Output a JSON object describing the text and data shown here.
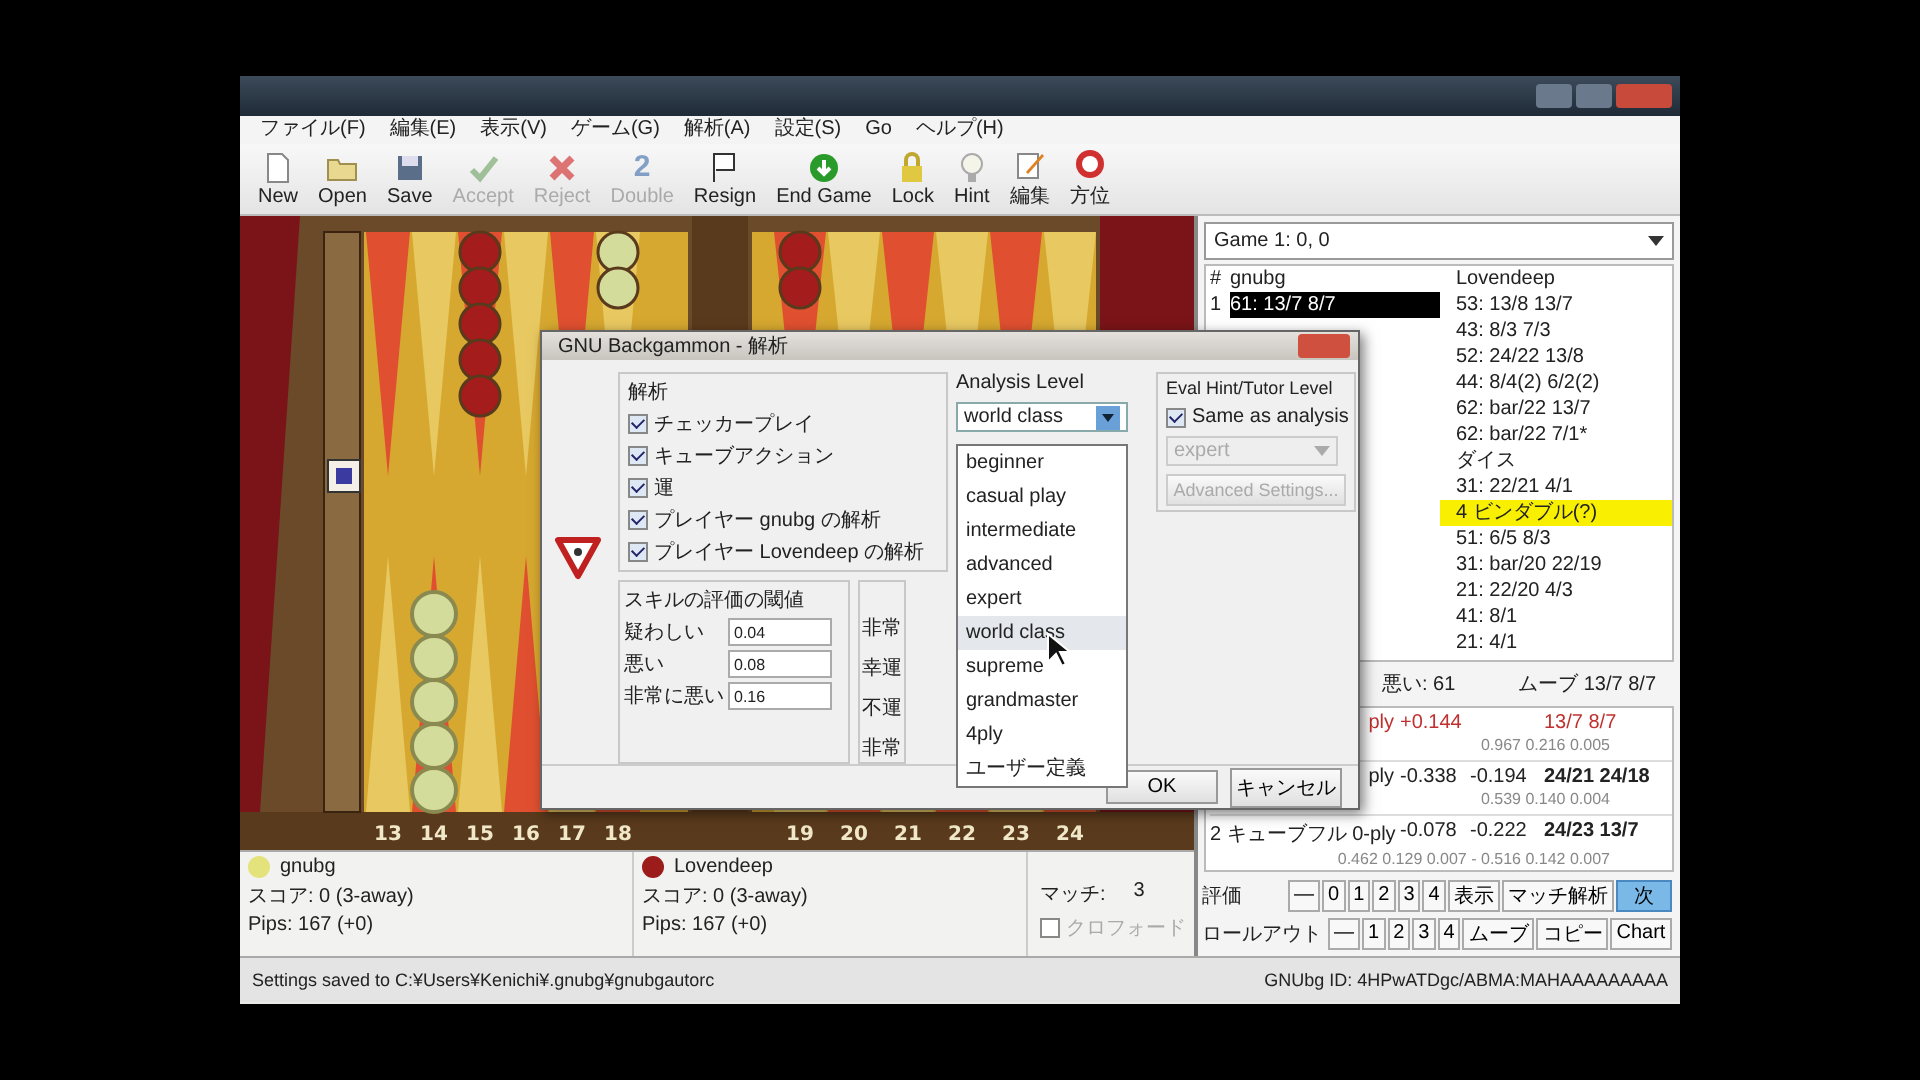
{
  "menu": [
    "ファイル(F)",
    "編集(E)",
    "表示(V)",
    "ゲーム(G)",
    "解析(A)",
    "設定(S)",
    "Go",
    "ヘルプ(H)"
  ],
  "toolbar": [
    {
      "label": "New",
      "kind": "new",
      "disabled": false
    },
    {
      "label": "Open",
      "kind": "open",
      "disabled": false
    },
    {
      "label": "Save",
      "kind": "save",
      "disabled": false
    },
    {
      "label": "Accept",
      "kind": "accept",
      "disabled": true
    },
    {
      "label": "Reject",
      "kind": "reject",
      "disabled": true
    },
    {
      "label": "Double",
      "kind": "double",
      "glyph": "2",
      "disabled": true
    },
    {
      "label": "Resign",
      "kind": "resign",
      "disabled": false
    },
    {
      "label": "End Game",
      "kind": "endgame",
      "disabled": false
    },
    {
      "label": "Lock",
      "kind": "lock",
      "disabled": false
    },
    {
      "label": "Hint",
      "kind": "hint",
      "disabled": false
    },
    {
      "label": "編集",
      "kind": "edit",
      "disabled": false
    },
    {
      "label": "方位",
      "kind": "target",
      "disabled": false
    }
  ],
  "board": {
    "point_numbers": [
      "13",
      "14",
      "15",
      "16",
      "17",
      "18",
      "19",
      "20",
      "21",
      "22",
      "23",
      "24"
    ]
  },
  "players": [
    {
      "name": "gnubg",
      "color": "#e4e27a",
      "score": "スコア: 0 (3-away)",
      "pips": "Pips: 167 (+0)"
    },
    {
      "name": "Lovendeep",
      "color": "#9c1c1c",
      "score": "スコア: 0 (3-away)",
      "pips": "Pips: 167 (+0)"
    }
  ],
  "match": {
    "label": "マッチ:",
    "value": "3",
    "crawford": {
      "label": "クロフォード",
      "checked": false,
      "disabled": true
    }
  },
  "game_select": "Game 1: 0, 0",
  "move_list": {
    "columns": [
      "#",
      "gnubg",
      "Lovendeep"
    ],
    "rows": [
      {
        "number": "1",
        "gnubg": "61: 13/7 8/7",
        "lovendeep": "53: 13/8 13/7",
        "selected": true,
        "highlighted": false
      },
      {
        "lovendeep": "43: 8/3 7/3",
        "highlighted": false
      },
      {
        "lovendeep": "52: 24/22 13/8",
        "highlighted": false
      },
      {
        "lovendeep": "44: 8/4(2) 6/2(2)",
        "highlighted": false
      },
      {
        "lovendeep": "62: bar/22 13/7",
        "highlighted": false
      },
      {
        "lovendeep": "62: bar/22 7/1*",
        "highlighted": false
      },
      {
        "lovendeep": "ダイス",
        "highlighted": false
      },
      {
        "lovendeep": "31: 22/21 4/1",
        "highlighted": false
      },
      {
        "lovendeep": "4 ビンダブル(?)",
        "highlighted": true
      },
      {
        "lovendeep": "51: 6/5 8/3",
        "highlighted": false
      },
      {
        "lovendeep": "31: bar/20 22/19",
        "highlighted": false
      },
      {
        "lovendeep": "21: 22/20 4/3",
        "highlighted": false
      },
      {
        "lovendeep": "41: 8/1",
        "highlighted": false
      },
      {
        "lovendeep": "21: 4/1",
        "highlighted": false
      }
    ]
  },
  "move_summary": {
    "left": "悪い: 61",
    "right": "ムーブ 13/7 8/7"
  },
  "analysis": [
    {
      "method": "ply",
      "equity": "+0.144",
      "move": "13/7 8/7",
      "probs": "0.967 0.216 0.005",
      "best": true
    },
    {
      "method": "ply",
      "equity": "-0.338",
      "diff": "-0.194",
      "move": "24/21 24/18",
      "probs": "0.539 0.140 0.004",
      "best": false
    },
    {
      "method": "2 キューブフル 0-ply",
      "equity": "-0.078",
      "diff": "-0.222",
      "move": "24/23 13/7",
      "probs": "0.462 0.129 0.007 - 0.516 0.142 0.007",
      "best": false
    }
  ],
  "tool_rows": [
    [
      {
        "label": "評価",
        "kind": "text"
      },
      {
        "label": "—",
        "kind": "small"
      },
      {
        "label": "0",
        "kind": "small"
      },
      {
        "label": "1",
        "kind": "small"
      },
      {
        "label": "2",
        "kind": "small"
      },
      {
        "label": "3",
        "kind": "small"
      },
      {
        "label": "4",
        "kind": "small"
      },
      {
        "label": "表示",
        "kind": "button"
      },
      {
        "label": "マッチ解析",
        "kind": "button"
      },
      {
        "label": "次",
        "kind": "primary"
      }
    ],
    [
      {
        "label": "ロールアウト",
        "kind": "text"
      },
      {
        "label": "—",
        "kind": "small"
      },
      {
        "label": "1",
        "kind": "small"
      },
      {
        "label": "2",
        "kind": "small"
      },
      {
        "label": "3",
        "kind": "small"
      },
      {
        "label": "4",
        "kind": "small"
      },
      {
        "label": "ムーブ",
        "kind": "small"
      },
      {
        "label": "コピー",
        "kind": "button"
      },
      {
        "label": "Chart",
        "kind": "button"
      }
    ]
  ],
  "status_bar": {
    "message": "Settings saved to C:¥Users¥Kenichi¥.gnubg¥gnubgautorc",
    "id": "GNUbg ID: 4HPwATDgc/ABMA:MAHAAAAAAAAA"
  },
  "dialog": {
    "title": "GNU Backgammon - 解析",
    "analysis_group": {
      "title": "解析",
      "options": [
        {
          "label": "チェッカープレイ",
          "checked": true
        },
        {
          "label": "キューブアクション",
          "checked": true
        },
        {
          "label": "運",
          "checked": true
        },
        {
          "label": "プレイヤー gnubg の解析",
          "checked": true
        },
        {
          "label": "プレイヤー Lovendeep の解析",
          "checked": true
        }
      ]
    },
    "threshold_group": {
      "title": "スキルの評価の閾値",
      "fields": [
        {
          "label": "疑わしい",
          "value": "0.04"
        },
        {
          "label": "悪い",
          "value": "0.08"
        },
        {
          "label": "非常に悪い",
          "value": "0.16"
        }
      ]
    },
    "luck_labels": [
      "非常",
      "幸運",
      "不運",
      "非常"
    ],
    "analysis_level": {
      "title": "Analysis Level",
      "value": "world class",
      "options": [
        {
          "label": "beginner",
          "selected": false
        },
        {
          "label": "casual play",
          "selected": false
        },
        {
          "label": "intermediate",
          "selected": false
        },
        {
          "label": "advanced",
          "selected": false
        },
        {
          "label": "expert",
          "selected": false
        },
        {
          "label": "world class",
          "selected": true
        },
        {
          "label": "supreme",
          "selected": false
        },
        {
          "label": "grandmaster",
          "selected": false
        },
        {
          "label": "4ply",
          "selected": false
        },
        {
          "label": "ユーザー定義",
          "selected": false
        }
      ]
    },
    "eval_hint": {
      "title": "Eval Hint/Tutor Level",
      "same": {
        "label": "Same as analysis",
        "checked": true
      },
      "level": {
        "value": "expert",
        "disabled": true
      },
      "advanced": {
        "label": "Advanced Settings...",
        "disabled": true
      }
    },
    "buttons": [
      "OK",
      "キャンセル"
    ]
  }
}
